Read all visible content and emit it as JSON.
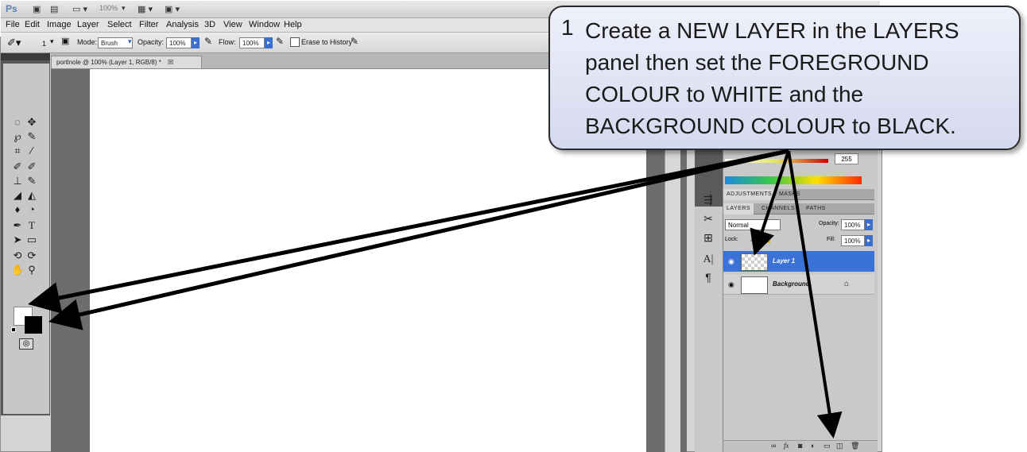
{
  "app_bar": {
    "logo": "Ps",
    "zoom": "100%"
  },
  "menu": [
    "File",
    "Edit",
    "Image",
    "Layer",
    "Select",
    "Filter",
    "Analysis",
    "3D",
    "View",
    "Window",
    "Help"
  ],
  "options_bar": {
    "brush_size": "1",
    "mode_label": "Mode:",
    "mode_value": "Brush",
    "opacity_label": "Opacity:",
    "opacity_value": "100%",
    "flow_label": "Flow:",
    "flow_value": "100%",
    "erase_history_label": "Erase to History"
  },
  "document": {
    "tab_title": "portlnole @ 100% (Layer 1, RGB/8) *"
  },
  "color_panel": {
    "value": "255"
  },
  "adjustments_tabs": [
    "ADJUSTMENTS",
    "MASKS"
  ],
  "layers_panel": {
    "tabs": [
      "LAYERS",
      "CHANNELS",
      "PATHS"
    ],
    "blend_mode": "Normal",
    "opacity_label": "Opacity:",
    "opacity_value": "100%",
    "lock_label": "Lock:",
    "fill_label": "Fill:",
    "fill_value": "100%",
    "layers": [
      {
        "name": "Layer 1",
        "selected": true
      },
      {
        "name": "Background",
        "selected": false
      }
    ]
  },
  "callout": {
    "number": "1",
    "text": "Create a NEW LAYER in the LAYERS panel then set the FOREGROUND COLOUR to WHITE and the BACKGROUND COLOUR to BLACK."
  },
  "colors": {
    "accent": "#3b72d8",
    "foreground": "#ffffff",
    "background": "#000000"
  }
}
